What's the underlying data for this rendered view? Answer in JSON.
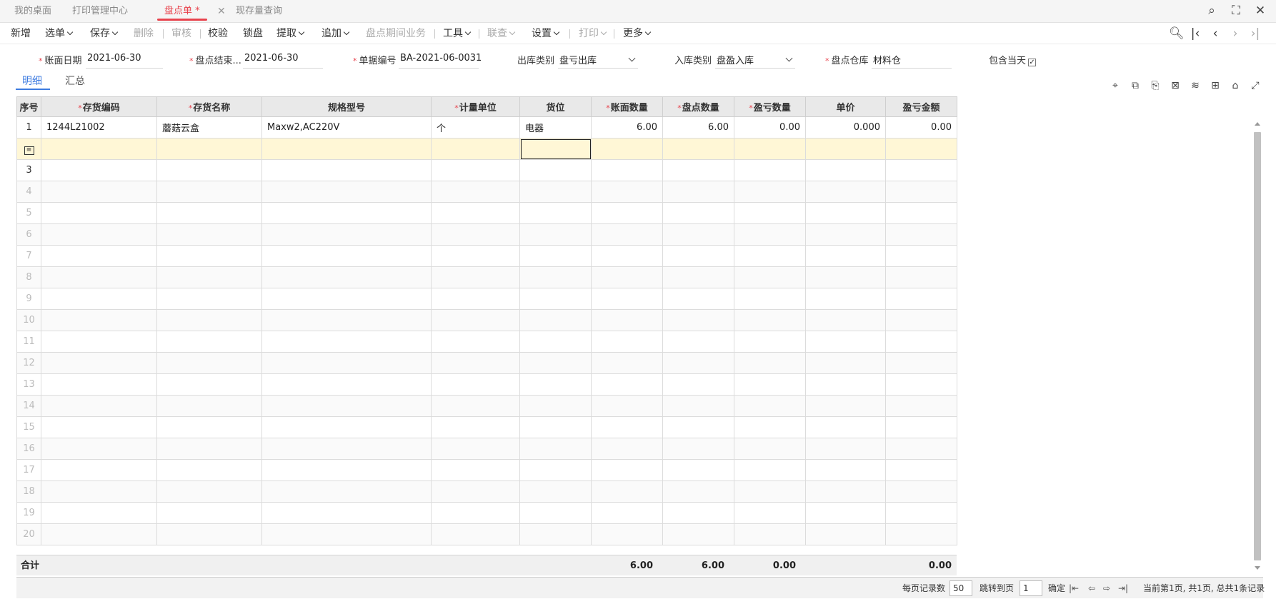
{
  "tabs": [
    {
      "label": "我的桌面"
    },
    {
      "label": "打印管理中心"
    },
    {
      "label": "盘点单 *"
    },
    {
      "label": "现存量查询"
    }
  ],
  "toolbar": {
    "new": "新增",
    "select": "选单",
    "save": "保存",
    "delete": "删除",
    "audit": "审核",
    "check": "校验",
    "lock": "锁盘",
    "fetch": "提取",
    "append": "追加",
    "period": "盘点期间业务",
    "tools": "工具",
    "link": "联查",
    "settings": "设置",
    "print": "打印",
    "more": "更多"
  },
  "form": {
    "date_label": "账面日期",
    "date_value": "2021-06-30",
    "end_label": "盘点结束...",
    "end_value": "2021-06-30",
    "code_label": "单据编号",
    "code_value": "BA-2021-06-0031",
    "out_label": "出库类别",
    "out_value": "盘亏出库",
    "in_label": "入库类别",
    "in_value": "盘盈入库",
    "wh_label": "盘点仓库",
    "wh_value": "材料仓",
    "today_label": "包含当天"
  },
  "subtabs": {
    "detail": "明细",
    "summary": "汇总"
  },
  "columns": [
    "序号",
    "存货编码",
    "存货名称",
    "规格型号",
    "计量单位",
    "货位",
    "账面数量",
    "盘点数量",
    "盈亏数量",
    "单价",
    "盈亏金额"
  ],
  "rows": [
    {
      "idx": "1",
      "code": "1244L21002",
      "name": "蘑菇云盒",
      "spec": "Maxw2,AC220V",
      "unit": "个",
      "loc": "电器",
      "book": "6.00",
      "count": "6.00",
      "diff": "0.00",
      "price": "0.000",
      "amount": "0.00"
    },
    {
      "idx": "",
      "code": "",
      "name": "",
      "spec": "",
      "unit": "",
      "loc": "",
      "book": "",
      "count": "",
      "diff": "",
      "price": "",
      "amount": ""
    },
    {
      "idx": "3"
    },
    {
      "idx": "4"
    },
    {
      "idx": "5"
    },
    {
      "idx": "6"
    },
    {
      "idx": "7"
    },
    {
      "idx": "8"
    },
    {
      "idx": "9"
    },
    {
      "idx": "10"
    },
    {
      "idx": "11"
    },
    {
      "idx": "12"
    },
    {
      "idx": "13"
    },
    {
      "idx": "14"
    },
    {
      "idx": "15"
    },
    {
      "idx": "16"
    },
    {
      "idx": "17"
    },
    {
      "idx": "18"
    },
    {
      "idx": "19"
    },
    {
      "idx": "20"
    }
  ],
  "totals": {
    "label": "合计",
    "book": "6.00",
    "count": "6.00",
    "diff": "0.00",
    "amount": "0.00"
  },
  "footer": {
    "per_page_label": "每页记录数",
    "per_page_value": "50",
    "goto_label": "跳转到页",
    "goto_value": "1",
    "confirm": "确定",
    "status": "当前第1页, 共1页, 总共1条记录"
  }
}
